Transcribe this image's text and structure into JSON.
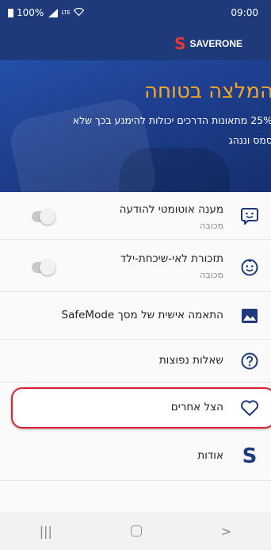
{
  "status_bar": {
    "battery": "100%",
    "network": "LTE",
    "time": "09:00"
  },
  "header": {
    "logo_mark": "S",
    "brand": "SAVERONE"
  },
  "hero": {
    "title": "המלצה בטוחה",
    "line1": "25% מתאונות הדרכים יכולות להימנע בכך שלא",
    "line2": "סמס וננהג"
  },
  "menu": {
    "items": [
      {
        "label": "מענה אוטומטי להודעה",
        "sub": "מכובה",
        "icon": "message-smile-icon",
        "toggle": false
      },
      {
        "label": "תזכורת לאי-שיכחת-ילד",
        "sub": "מכובה",
        "icon": "baby-face-icon",
        "toggle": false
      },
      {
        "label": "התאמה אישית של מסך SafeMode",
        "icon": "image-icon"
      },
      {
        "label": "שאלות נפוצות",
        "icon": "help-circle-icon"
      },
      {
        "label": "הצל אחרים",
        "icon": "heart-icon",
        "highlighted": true
      },
      {
        "label": "אודות",
        "icon": "saverone-s-icon"
      }
    ]
  },
  "nav": {
    "recents": "|||",
    "back": ">"
  },
  "colors": {
    "header_bg": "#1e3a7b",
    "hero_title": "#f5a623",
    "highlight_border": "#d9232d",
    "icon_blue": "#1e3a7b",
    "logo_red": "#e53935"
  }
}
